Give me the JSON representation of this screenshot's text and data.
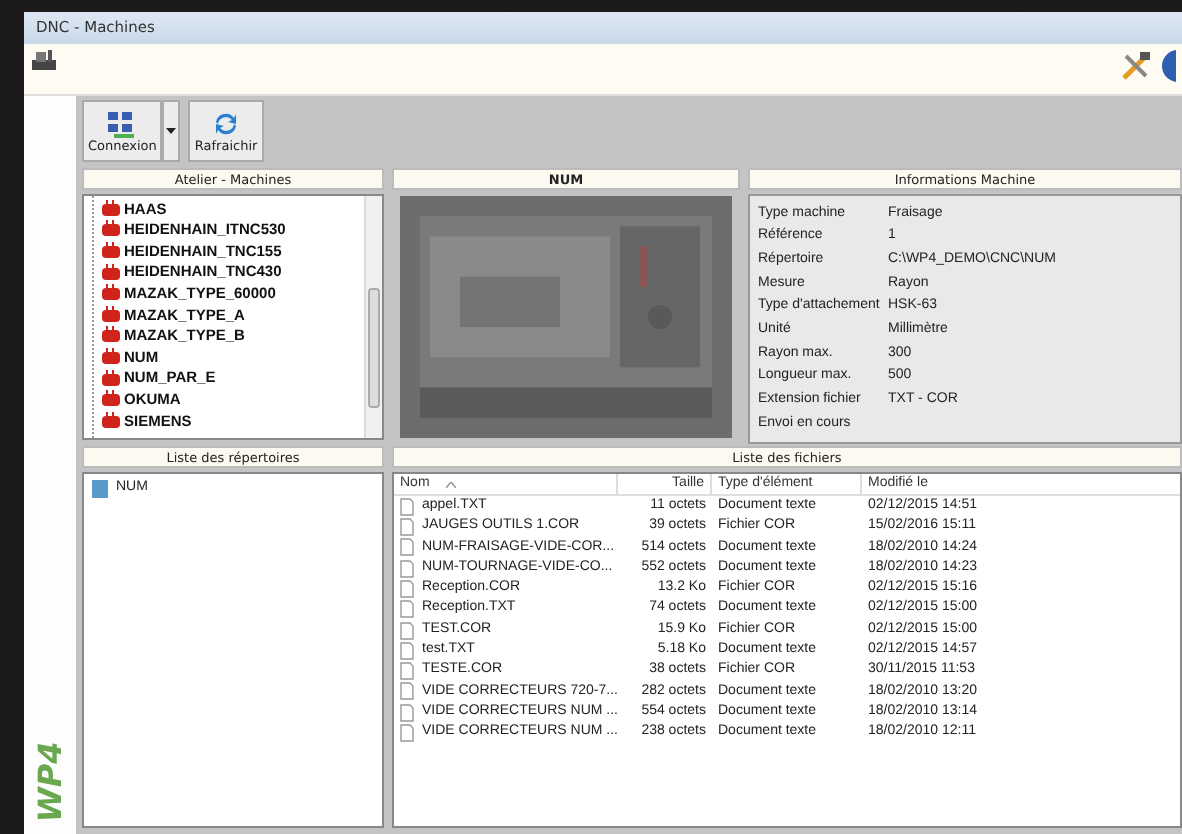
{
  "window": {
    "title": "DNC - Machines"
  },
  "side_logo": "WP4",
  "toolbar": {
    "buttons": [
      {
        "label": "Connexion",
        "kind": "dropdown"
      },
      {
        "label": "Rafraichir",
        "kind": "plain"
      }
    ]
  },
  "machines_panel": {
    "title": "Atelier - Machines",
    "items": [
      {
        "label": "HAAS"
      },
      {
        "label": "HEIDENHAIN_ITNC530"
      },
      {
        "label": "HEIDENHAIN_TNC155"
      },
      {
        "label": "HEIDENHAIN_TNC430"
      },
      {
        "label": "MAZAK_TYPE_60000"
      },
      {
        "label": "MAZAK_TYPE_A"
      },
      {
        "label": "MAZAK_TYPE_B"
      },
      {
        "label": "NUM"
      },
      {
        "label": "NUM_PAR_E"
      },
      {
        "label": "OKUMA"
      },
      {
        "label": "SIEMENS"
      }
    ]
  },
  "image_panel": {
    "title": "NUM"
  },
  "info_panel": {
    "title": "Informations Machine",
    "fields": [
      {
        "label": "Type machine",
        "value": "Fraisage"
      },
      {
        "label": "Référence",
        "value": "1"
      },
      {
        "label": "Répertoire",
        "value": "C:\\WP4_DEMO\\CNC\\NUM"
      },
      {
        "label": "Mesure",
        "value": "Rayon"
      },
      {
        "label": "Type d'attachement",
        "value": "HSK-63"
      },
      {
        "label": "Unité",
        "value": "Millimètre"
      },
      {
        "label": "Rayon max.",
        "value": "300"
      },
      {
        "label": "Longueur max.",
        "value": "500"
      },
      {
        "label": "Extension fichier",
        "value": "TXT - COR"
      },
      {
        "label": "Envoi en cours"
      }
    ]
  },
  "directories_panel": {
    "title": "Liste des répertoires",
    "items": [
      {
        "label": "NUM"
      }
    ]
  },
  "files_panel": {
    "title": "Liste des fichiers",
    "columns": [
      "Nom",
      "Taille",
      "Type d'élément",
      "Modifié le"
    ],
    "rows": [
      [
        "appel.TXT",
        "11 octets",
        "Document texte",
        "02/12/2015 14:51"
      ],
      [
        "JAUGES OUTILS 1.COR",
        "39 octets",
        "Fichier COR",
        "15/02/2016 15:11"
      ],
      [
        "NUM-FRAISAGE-VIDE-COR...",
        "514 octets",
        "Document texte",
        "18/02/2010 14:24"
      ],
      [
        "NUM-TOURNAGE-VIDE-CO...",
        "552 octets",
        "Document texte",
        "18/02/2010 14:23"
      ],
      [
        "Reception.COR",
        "13.2 Ko",
        "Fichier COR",
        "02/12/2015 15:16"
      ],
      [
        "Reception.TXT",
        "74 octets",
        "Document texte",
        "02/12/2015 15:00"
      ],
      [
        "TEST.COR",
        "15.9 Ko",
        "Fichier COR",
        "02/12/2015 15:00"
      ],
      [
        "test.TXT",
        "5.18 Ko",
        "Document texte",
        "02/12/2015 14:57"
      ],
      [
        "TESTE.COR",
        "38 octets",
        "Fichier COR",
        "30/11/2015 11:53"
      ],
      [
        "VIDE CORRECTEURS 720-7...",
        "282 octets",
        "Document texte",
        "18/02/2010 13:20"
      ],
      [
        "VIDE CORRECTEURS NUM ...",
        "554 octets",
        "Document texte",
        "18/02/2010 13:14"
      ],
      [
        "VIDE CORRECTEURS NUM ...",
        "238 octets",
        "Document texte",
        "18/02/2010 12:11"
      ]
    ]
  }
}
